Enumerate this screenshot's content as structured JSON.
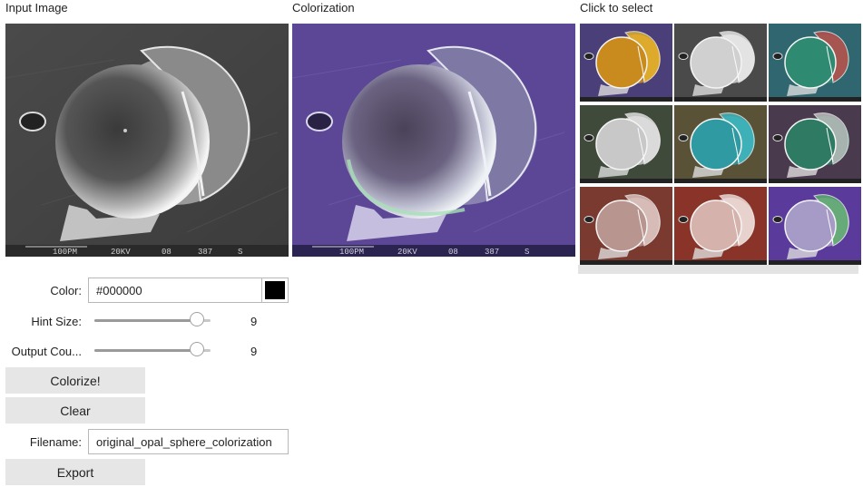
{
  "headings": {
    "input": "Input Image",
    "colorization": "Colorization",
    "select": "Click to select"
  },
  "image_caption": {
    "scale": "100PM",
    "voltage": "20KV",
    "code": "08",
    "number": "387",
    "letter": "S"
  },
  "controls": {
    "color_label": "Color:",
    "color_value": "#000000",
    "swatch_color": "#000000",
    "hint_label": "Hint Size:",
    "hint_value": "9",
    "hint_fraction": 0.88,
    "output_label": "Output Cou...",
    "output_value": "9",
    "output_fraction": 0.88,
    "colorize_label": "Colorize!",
    "clear_label": "Clear",
    "filename_label": "Filename:",
    "filename_value": "original_opal_sphere_colorization",
    "export_label": "Export"
  },
  "thumbnails": [
    {
      "bg": "#4a3f78",
      "sphere": "#c98a1e",
      "spot": "#e7b62c"
    },
    {
      "bg": "#4a4a4a",
      "sphere": "#d0d0d0",
      "spot": "#ededed"
    },
    {
      "bg": "#2f6670",
      "sphere": "#2f8a72",
      "spot": "#c44a4a"
    },
    {
      "bg": "#3f4a3a",
      "sphere": "#c8c8c8",
      "spot": "#e4e4e4"
    },
    {
      "bg": "#5a5236",
      "sphere": "#2f9aa2",
      "spot": "#3fb9c2"
    },
    {
      "bg": "#4a3a4e",
      "sphere": "#2f7a62",
      "spot": "#c4c4c4"
    },
    {
      "bg": "#7a3a30",
      "sphere": "#b8958e",
      "spot": "#e0c8c4"
    },
    {
      "bg": "#8a3328",
      "sphere": "#d6b2ac",
      "spot": "#f0e0dc"
    },
    {
      "bg": "#5a3a9a",
      "sphere": "#a69ac6",
      "spot": "#5ab26a"
    }
  ],
  "colors": {
    "colorized_bg": "#5b4796",
    "colorized_sphere": "#8c86a4",
    "colorized_rim": "#a8e0b8"
  }
}
